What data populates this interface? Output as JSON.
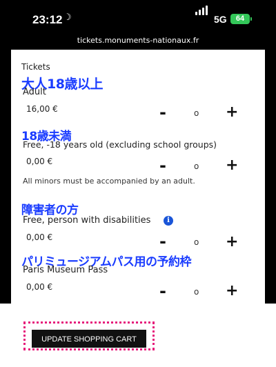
{
  "status": {
    "time": "23:12",
    "network": "5G",
    "battery": "64"
  },
  "browser": {
    "url": "tickets.monuments-nationaux.fr"
  },
  "section_label": "Tickets",
  "tickets": [
    {
      "annotation": "大人18歳以上",
      "name": "Adult",
      "price": "16,00 €",
      "minus": "-",
      "qty": "o",
      "plus": "+"
    },
    {
      "annotation": "18歳未満",
      "name": "Free, -18 years old (excluding school groups)",
      "price": "0,00 €",
      "minus": "-",
      "qty": "o",
      "plus": "+",
      "note": "All minors must be accompanied by an adult."
    },
    {
      "annotation": "障害者の方",
      "name": "Free, person with disabilities",
      "price": "0,00 €",
      "minus": "-",
      "qty": "o",
      "plus": "+",
      "info": "i"
    },
    {
      "annotation": "パリミュージアムパス用の予約枠",
      "name": "Paris Museum Pass",
      "price": "0,00 €",
      "minus": "-",
      "qty": "o",
      "plus": "+"
    }
  ],
  "cart_button": "UPDATE SHOPPING CART",
  "colors": {
    "annotation": "#1a3cff",
    "highlight_frame": "#e6197a",
    "info_icon": "#1a55d8",
    "battery": "#33c759"
  }
}
